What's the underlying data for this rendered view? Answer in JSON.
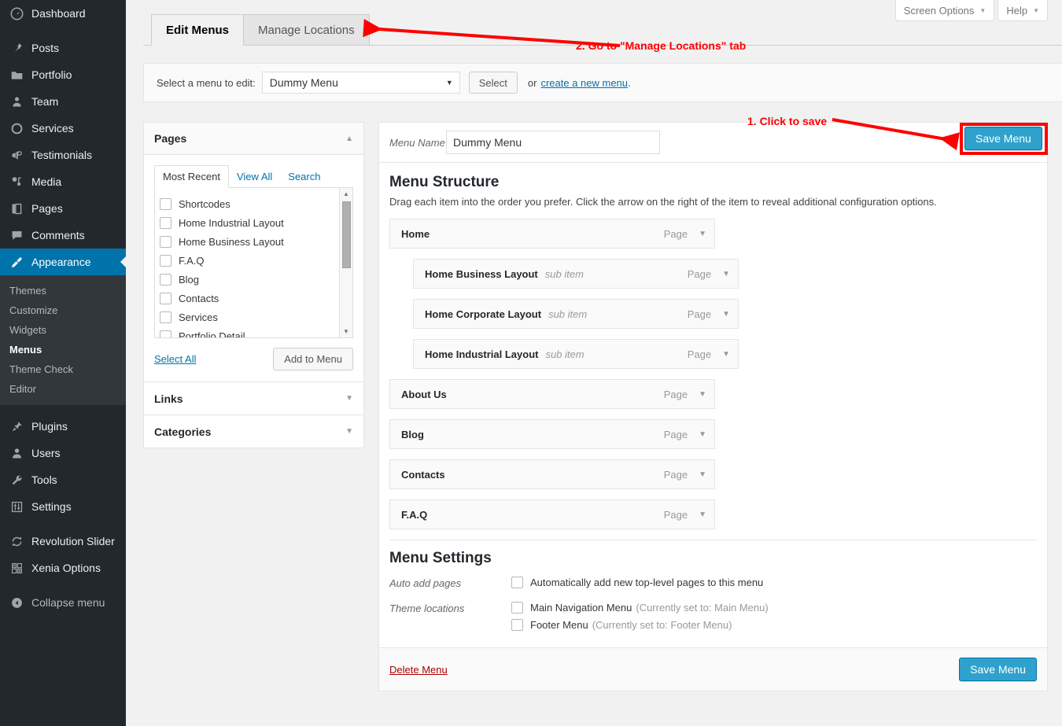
{
  "sidebar": {
    "items": [
      {
        "label": "Dashboard",
        "icon": "dashboard-icon"
      },
      {
        "label": "Posts",
        "icon": "pin-icon"
      },
      {
        "label": "Portfolio",
        "icon": "folder-icon"
      },
      {
        "label": "Team",
        "icon": "person-icon"
      },
      {
        "label": "Services",
        "icon": "circle-icon"
      },
      {
        "label": "Testimonials",
        "icon": "megaphone-icon"
      },
      {
        "label": "Media",
        "icon": "media-icon"
      },
      {
        "label": "Pages",
        "icon": "pages-icon"
      },
      {
        "label": "Comments",
        "icon": "comment-icon"
      },
      {
        "label": "Appearance",
        "icon": "brush-icon",
        "active": true
      }
    ],
    "submenu": [
      {
        "label": "Themes"
      },
      {
        "label": "Customize"
      },
      {
        "label": "Widgets"
      },
      {
        "label": "Menus",
        "current": true
      },
      {
        "label": "Theme Check"
      },
      {
        "label": "Editor"
      }
    ],
    "items_after": [
      {
        "label": "Plugins",
        "icon": "plug-icon"
      },
      {
        "label": "Users",
        "icon": "users-icon"
      },
      {
        "label": "Tools",
        "icon": "wrench-icon"
      },
      {
        "label": "Settings",
        "icon": "sliders-icon"
      }
    ],
    "items_last": [
      {
        "label": "Revolution Slider",
        "icon": "refresh-icon"
      },
      {
        "label": "Xenia Options",
        "icon": "grid-icon"
      }
    ],
    "collapse": {
      "label": "Collapse menu",
      "icon": "collapse-icon"
    },
    "active_color": "#0073aa"
  },
  "header": {
    "screen_options": "Screen Options",
    "help": "Help",
    "caret": "▼"
  },
  "tabs": [
    {
      "label": "Edit Menus",
      "active": true
    },
    {
      "label": "Manage Locations",
      "active": false
    }
  ],
  "selector_bar": {
    "label": "Select a menu to edit:",
    "selected_menu": "Dummy Menu",
    "select_button": "Select",
    "or_text": "or",
    "create_link": "create a new menu",
    "period": "."
  },
  "pages_panel": {
    "title": "Pages",
    "collapse_icon": "▲",
    "tabs": [
      {
        "label": "Most Recent",
        "active": true
      },
      {
        "label": "View All",
        "active": false
      },
      {
        "label": "Search",
        "active": false
      }
    ],
    "items": [
      "Shortcodes",
      "Home Industrial Layout",
      "Home Business Layout",
      "F.A.Q",
      "Blog",
      "Contacts",
      "Services",
      "Portfolio Detail"
    ],
    "select_all": "Select All",
    "add_to_menu": "Add to Menu"
  },
  "links_panel": {
    "title": "Links",
    "expand_icon": "▼"
  },
  "categories_panel": {
    "title": "Categories",
    "expand_icon": "▼"
  },
  "menu_editor": {
    "name_label": "Menu Name",
    "name_value": "Dummy Menu",
    "save_button": "Save Menu",
    "structure_title": "Menu Structure",
    "structure_desc": "Drag each item into the order you prefer. Click the arrow on the right of the item to reveal additional configuration options.",
    "items": [
      {
        "label": "Home",
        "sub": "",
        "type": "Page",
        "depth": 0
      },
      {
        "label": "Home Business Layout",
        "sub": "sub item",
        "type": "Page",
        "depth": 1
      },
      {
        "label": "Home Corporate Layout",
        "sub": "sub item",
        "type": "Page",
        "depth": 1
      },
      {
        "label": "Home Industrial Layout",
        "sub": "sub item",
        "type": "Page",
        "depth": 1
      },
      {
        "label": "About Us",
        "sub": "",
        "type": "Page",
        "depth": 0
      },
      {
        "label": "Blog",
        "sub": "",
        "type": "Page",
        "depth": 0
      },
      {
        "label": "Contacts",
        "sub": "",
        "type": "Page",
        "depth": 0
      },
      {
        "label": "F.A.Q",
        "sub": "",
        "type": "Page",
        "depth": 0
      }
    ]
  },
  "menu_settings": {
    "title": "Menu Settings",
    "auto_add_label": "Auto add pages",
    "auto_add_option": "Automatically add new top-level pages to this menu",
    "theme_locations_label": "Theme locations",
    "locations": [
      {
        "name": "Main Navigation Menu",
        "current": "(Currently set to: Main Menu)"
      },
      {
        "name": "Footer Menu",
        "current": "(Currently set to: Footer Menu)"
      }
    ]
  },
  "footer_bar": {
    "delete_menu": "Delete Menu",
    "save_button": "Save Menu"
  },
  "annotations": [
    {
      "text": "1. Click to save"
    },
    {
      "text": "2. Go to \"Manage Locations\" tab"
    }
  ],
  "colors": {
    "annotation": "#ff0000",
    "primary_button": "#2ea2cc",
    "link": "#0073aa",
    "delete_link": "#a00"
  }
}
